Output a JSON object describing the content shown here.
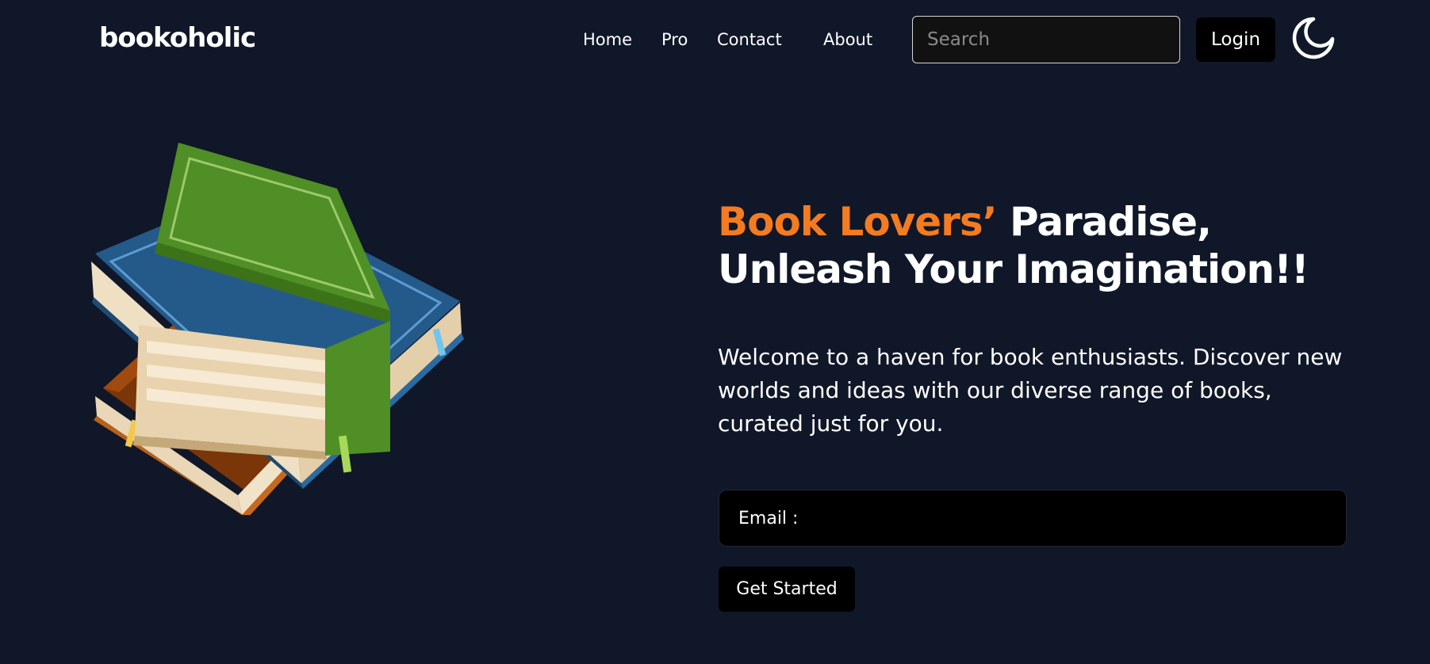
{
  "navbar": {
    "logo": "bookoholic",
    "links": [
      "Home",
      "Pro",
      "Contact",
      "About"
    ],
    "search_placeholder": "Search",
    "login_label": "Login",
    "theme_icon": "moon-icon"
  },
  "hero": {
    "image": "stacked-books-illustration",
    "title_accent": "Book Lovers’",
    "title_rest_line1": " Paradise,",
    "title_line2": "Unleash Your Imagination!!",
    "description": "Welcome to a haven for book enthusiasts. Discover new worlds and ideas with our diverse range of books, curated just for you.",
    "email_label": "Email :",
    "cta_label": "Get Started"
  },
  "colors": {
    "background": "#101728",
    "accent": "#f47b20",
    "button": "#000000"
  }
}
